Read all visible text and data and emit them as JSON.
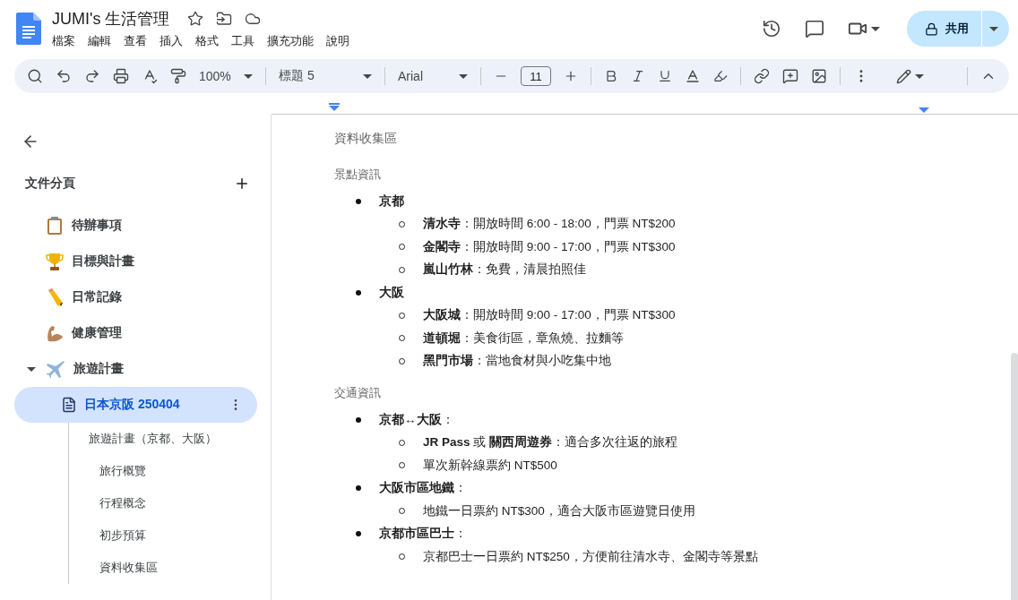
{
  "doc_title": "JUMI's 生活管理",
  "menu": [
    "檔案",
    "編輯",
    "查看",
    "插入",
    "格式",
    "工具",
    "擴充功能",
    "說明"
  ],
  "share_button": "共用",
  "toolbar": {
    "zoom": "100%",
    "style": "標題 5",
    "font": "Arial",
    "font_size": "11"
  },
  "sidebar": {
    "heading": "文件分頁",
    "tabs": [
      {
        "kind": "clipboard",
        "label": "待辦事項",
        "selected": false
      },
      {
        "kind": "trophy",
        "label": "目標與計畫",
        "selected": false
      },
      {
        "kind": "pencil",
        "label": "日常記錄",
        "selected": false
      },
      {
        "kind": "arm",
        "label": "健康管理",
        "selected": false
      },
      {
        "kind": "plane",
        "label": "旅遊計畫",
        "selected": false,
        "expanded": true,
        "children": [
          {
            "kind": "document",
            "label": "日本京阪 250404",
            "selected": true,
            "outline": [
              {
                "text": "旅遊計畫（京都、大阪）",
                "children": [
                  {
                    "text": "旅行概覽"
                  },
                  {
                    "text": "行程概念"
                  },
                  {
                    "text": "初步預算"
                  },
                  {
                    "text": "資料收集區"
                  }
                ]
              }
            ]
          }
        ]
      }
    ]
  },
  "document": {
    "heading": "資料收集區",
    "sections": [
      {
        "title": "景點資訊",
        "items": [
          {
            "text": "**京都**",
            "children": [
              {
                "text": "**清水寺**：開放時間 6:00 - 18:00，門票 NT$200"
              },
              {
                "text": "**金閣寺**：開放時間 9:00 - 17:00，門票 NT$300"
              },
              {
                "text": "**嵐山竹林**：免費，清晨拍照佳"
              }
            ]
          },
          {
            "text": "**大阪**",
            "children": [
              {
                "text": "**大阪城**：開放時間 9:00 - 17:00，門票 NT$300"
              },
              {
                "text": "**道頓堀**：美食街區，章魚燒、拉麵等"
              },
              {
                "text": "**黑門市場**：當地食材與小吃集中地"
              }
            ]
          }
        ]
      },
      {
        "title": "交通資訊",
        "items": [
          {
            "text": "**京都↔大阪**：",
            "children": [
              {
                "text": "**JR Pass** 或 **關西周遊券**：適合多次往返的旅程"
              },
              {
                "text": "單次新幹線票約 NT$500"
              }
            ]
          },
          {
            "text": "**大阪市區地鐵**：",
            "children": [
              {
                "text": "地鐵一日票約 NT$300，適合大阪市區遊覽日使用"
              }
            ]
          },
          {
            "text": "**京都市區巴士**：",
            "children": [
              {
                "text": "京都巴士一日票約 NT$250，方便前往清水寺、金閣寺等景點"
              }
            ]
          }
        ]
      }
    ]
  }
}
